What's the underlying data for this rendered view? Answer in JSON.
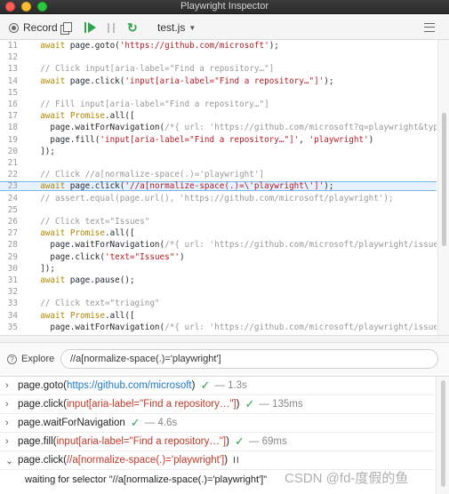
{
  "window": {
    "title": "Playwright Inspector"
  },
  "toolbar": {
    "record_label": "Record",
    "file_label": "test.js",
    "icons": [
      "record-icon",
      "copy-icon",
      "resume-icon",
      "pause-icon",
      "step-over-icon",
      "menu-icon"
    ]
  },
  "editor": {
    "lines": [
      {
        "n": "11",
        "t": "  await page.goto('https://github.com/microsoft');"
      },
      {
        "n": "12",
        "t": ""
      },
      {
        "n": "13",
        "t": "  // Click input[aria-label=\"Find a repository…\"]"
      },
      {
        "n": "14",
        "t": "  await page.click('input[aria-label=\"Find a repository…\"]');"
      },
      {
        "n": "15",
        "t": ""
      },
      {
        "n": "16",
        "t": "  // Fill input[aria-label=\"Find a repository…\"]"
      },
      {
        "n": "17",
        "t": "  await Promise.all(["
      },
      {
        "n": "18",
        "t": "    page.waitForNavigation(/*{ url: 'https://github.com/microsoft?q=playwright&type=a"
      },
      {
        "n": "19",
        "t": "    page.fill('input[aria-label=\"Find a repository…\"]', 'playwright')"
      },
      {
        "n": "20",
        "t": "  ]);"
      },
      {
        "n": "21",
        "t": ""
      },
      {
        "n": "22",
        "t": "  // Click //a[normalize-space(.)='playwright']"
      },
      {
        "n": "23",
        "t": "  await page.click('//a[normalize-space(.)=\\'playwright\\']');"
      },
      {
        "n": "24",
        "t": "  // assert.equal(page.url(), 'https://github.com/microsoft/playwright');"
      },
      {
        "n": "25",
        "t": ""
      },
      {
        "n": "26",
        "t": "  // Click text=\"Issues\""
      },
      {
        "n": "27",
        "t": "  await Promise.all(["
      },
      {
        "n": "28",
        "t": "    page.waitForNavigation(/*{ url: 'https://github.com/microsoft/playwright/issues' "
      },
      {
        "n": "29",
        "t": "    page.click('text=\"Issues\"')"
      },
      {
        "n": "30",
        "t": "  ]);"
      },
      {
        "n": "31",
        "t": "  await page.pause();"
      },
      {
        "n": "32",
        "t": ""
      },
      {
        "n": "33",
        "t": "  // Click text=\"triaging\""
      },
      {
        "n": "34",
        "t": "  await Promise.all(["
      },
      {
        "n": "35",
        "t": "    page.waitForNavigation(/*{ url: 'https://github.com/microsoft/playwright/issues?q"
      }
    ],
    "highlighted_line": "23"
  },
  "explore": {
    "label": "Explore",
    "value": "//a[normalize-space(.)='playwright']"
  },
  "log": {
    "entries": [
      {
        "chevron": "›",
        "method": "page.goto(",
        "arg": "https://github.com/microsoft",
        "arg_style": "link",
        "close": ")",
        "status": "✓",
        "duration": "— 1.3s"
      },
      {
        "chevron": "›",
        "method": "page.click(",
        "arg": "input[aria-label=\"Find a repository…\"]",
        "arg_style": "red",
        "close": ")",
        "status": "✓",
        "duration": "— 135ms"
      },
      {
        "chevron": "›",
        "method": "page.waitForNavigation",
        "arg": "",
        "arg_style": "",
        "close": "",
        "status": "✓",
        "duration": "— 4.6s"
      },
      {
        "chevron": "›",
        "method": "page.fill(",
        "arg": "input[aria-label=\"Find a repository…\"]",
        "arg_style": "red",
        "close": ")",
        "status": "✓",
        "duration": "— 69ms"
      },
      {
        "chevron": "⌄",
        "method": "page.click(",
        "arg": "//a[normalize-space(.)='playwright']",
        "arg_style": "red",
        "close": ")",
        "status": "",
        "duration": "",
        "paused": "II"
      }
    ],
    "detail": "waiting for selector \"//a[normalize-space(.)='playwright']\""
  },
  "watermark": "CSDN @fd-度假的鱼",
  "colors": {
    "keyword": "#b08800",
    "string": "#b31d28",
    "comment": "#999999",
    "success": "#2ea44f",
    "highlight_bg": "#e6f2ff",
    "highlight_border": "#7ab6e8",
    "link": "#1f78c8"
  }
}
